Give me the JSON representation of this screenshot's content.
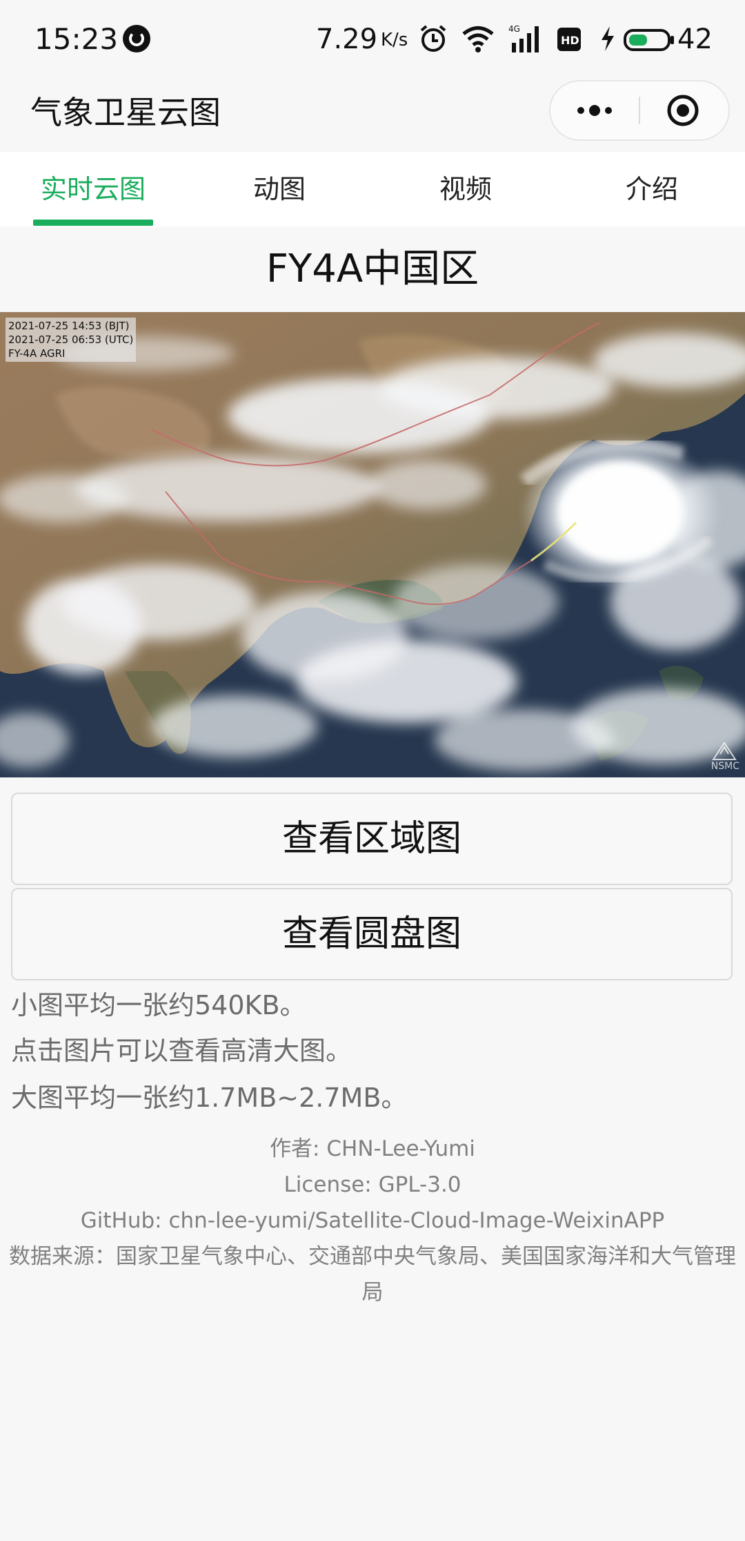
{
  "status_bar": {
    "time": "15:23",
    "speed": "7.29",
    "speed_unit": "K/s",
    "network": "4G",
    "hd": "HD",
    "battery": "42",
    "icons": [
      "notification-icon",
      "alarm-icon",
      "wifi-icon",
      "signal-icon",
      "hd-icon",
      "charging-icon",
      "battery-icon"
    ]
  },
  "nav": {
    "title": "气象卫星云图",
    "more_icon": "more-dots-icon",
    "target_icon": "target-icon"
  },
  "tabs": [
    {
      "label": "实时云图",
      "active": true
    },
    {
      "label": "动图",
      "active": false
    },
    {
      "label": "视频",
      "active": false
    },
    {
      "label": "介绍",
      "active": false
    }
  ],
  "main": {
    "region_title": "FY4A中国区",
    "image_caption": "2021-07-25 14:53 (BJT)\n2021-07-25 06:53 (UTC)\nFY-4A AGRI",
    "image_logo": "NSMC",
    "buttons": {
      "region": "查看区域图",
      "disk": "查看圆盘图"
    },
    "notes": [
      "小图平均一张约540KB。",
      "点击图片可以查看高清大图。",
      "大图平均一张约1.7MB~2.7MB。"
    ]
  },
  "footer": {
    "author": "作者: CHN-Lee-Yumi",
    "license": "License: GPL-3.0",
    "github": "GitHub: chn-lee-yumi/Satellite-Cloud-Image-WeixinAPP",
    "source": "数据来源：国家卫星气象中心、交通部中央气象局、美国国家海洋和大气管理局"
  },
  "colors": {
    "accent": "#1aad5c",
    "background": "#f7f7f7",
    "muted_text": "#6b6b6b",
    "footer_text": "#808080"
  }
}
